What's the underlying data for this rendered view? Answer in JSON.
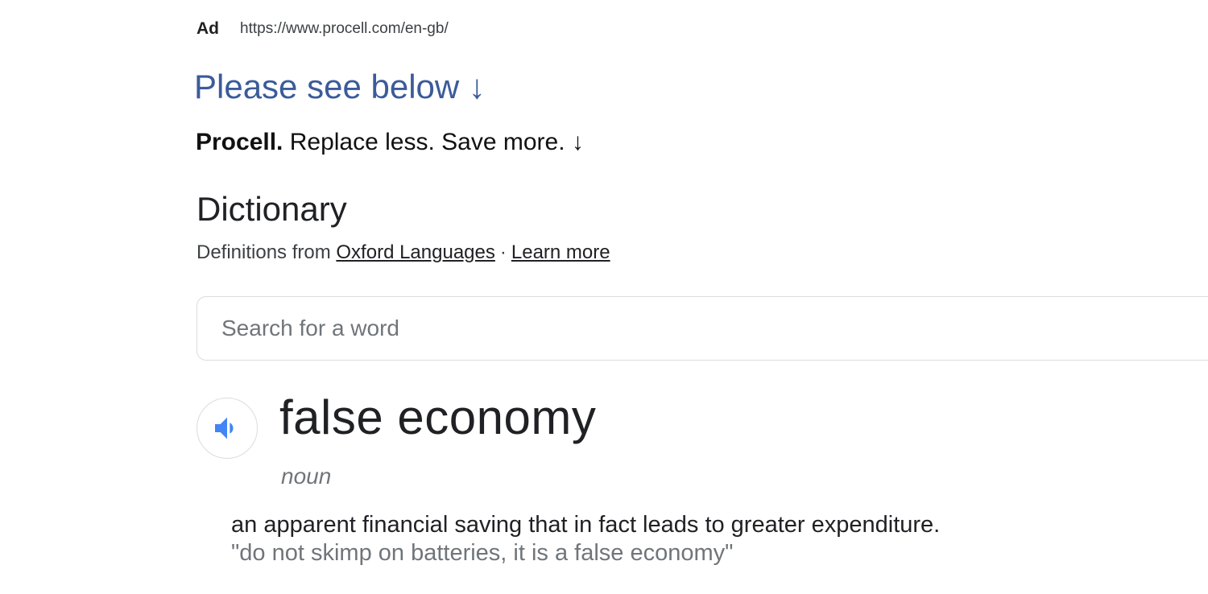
{
  "ad": {
    "label": "Ad",
    "url": "https://www.procell.com/en-gb/",
    "headline": "Please see below ↓",
    "tagline_brand": "Procell.",
    "tagline_rest": " Replace less. Save more. ↓"
  },
  "dictionary": {
    "title": "Dictionary",
    "source_prefix": "Definitions from ",
    "source_link": "Oxford Languages",
    "separator": "·",
    "learn_more": "Learn more",
    "search_placeholder": "Search for a word",
    "audio_icon": "speaker-icon",
    "accent_color": "#4285f4",
    "word": "false economy",
    "part_of_speech": "noun",
    "definition": "an apparent financial saving that in fact leads to greater expenditure.",
    "example": "\"do not skimp on batteries, it is a false economy\""
  }
}
